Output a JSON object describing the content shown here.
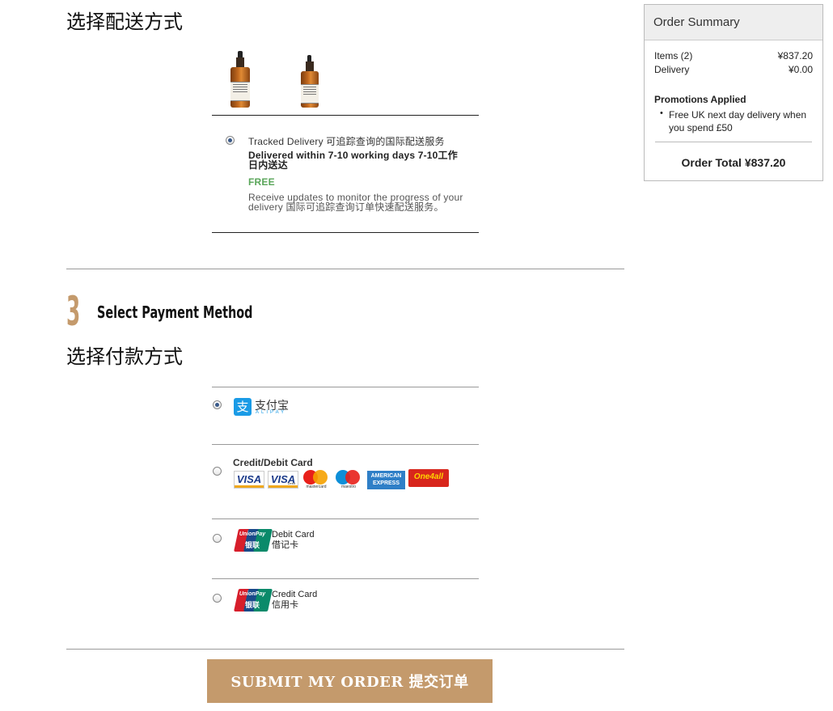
{
  "shipping": {
    "heading_cn": "选择配送方式",
    "option": {
      "name": "Tracked Delivery 可追踪查询的国际配送服务",
      "timeframe": "Delivered within 7-10 working days 7-10工作日内送达",
      "price": "FREE",
      "desc": "Receive updates to monitor the progress of your delivery 国际可追踪查询订单快速配送服务。"
    }
  },
  "payment": {
    "step_number": "3",
    "step_title": "Select Payment Method",
    "heading_cn": "选择付款方式",
    "alipay": {
      "cn": "支付宝",
      "en": "ALIPAY"
    },
    "card": {
      "label": "Credit/Debit Card",
      "visa": "VISA",
      "visa_debit_sub": "Debit",
      "mastercard": "mastercard",
      "maestro": "maestro",
      "amex": "AMERICAN EXPRESS",
      "one4all": "One4all"
    },
    "unionpay_logo": {
      "en": "UnionPay",
      "cn": "银联"
    },
    "unionpay_debit": {
      "en": "Debit Card",
      "cn": "借记卡"
    },
    "unionpay_credit": {
      "en": "Credit Card",
      "cn": "信用卡"
    }
  },
  "submit_label": "SUBMIT MY ORDER 提交订单",
  "summary": {
    "title": "Order Summary",
    "items_label": "Items (2)",
    "items_value": "¥837.20",
    "delivery_label": "Delivery",
    "delivery_value": "¥0.00",
    "promotions_title": "Promotions Applied",
    "promotion": "Free UK next day delivery when you spend £50",
    "total": "Order Total ¥837.20"
  },
  "colors": {
    "accent": "#c49a6c",
    "free_green": "#5aa65a",
    "alipay_blue": "#1a9be6",
    "unionpay_red": "#d71e2b",
    "unionpay_blue": "#1a4a8a",
    "unionpay_green": "#0a8a6a"
  }
}
